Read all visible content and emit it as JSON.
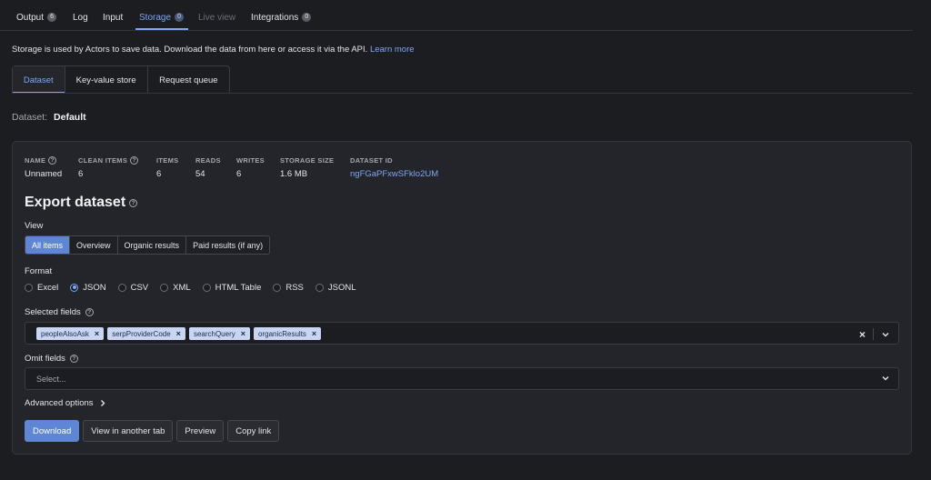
{
  "tabs": [
    {
      "label": "Output",
      "count": "6"
    },
    {
      "label": "Log"
    },
    {
      "label": "Input"
    },
    {
      "label": "Storage",
      "count": "0"
    },
    {
      "label": "Live view"
    },
    {
      "label": "Integrations",
      "count": "0"
    }
  ],
  "intro": {
    "text": "Storage is used by Actors to save data. Download the data from here or access it via the API.",
    "link": "Learn more"
  },
  "subtabs": [
    "Dataset",
    "Key-value store",
    "Request queue"
  ],
  "dataset_label": {
    "key": "Dataset:",
    "value": "Default"
  },
  "stats": [
    {
      "label": "NAME",
      "value": "Unnamed"
    },
    {
      "label": "CLEAN ITEMS",
      "value": "6"
    },
    {
      "label": "ITEMS",
      "value": "6"
    },
    {
      "label": "READS",
      "value": "54"
    },
    {
      "label": "WRITES",
      "value": "6"
    },
    {
      "label": "STORAGE SIZE",
      "value": "1.6 MB"
    },
    {
      "label": "DATASET ID",
      "value": "ngFGaPFxwSFklo2UM"
    }
  ],
  "export": {
    "title": "Export dataset",
    "view_label": "View",
    "view_options": [
      "All items",
      "Overview",
      "Organic results",
      "Paid results (if any)"
    ],
    "format_label": "Format",
    "formats": [
      "Excel",
      "JSON",
      "CSV",
      "XML",
      "HTML Table",
      "RSS",
      "JSONL"
    ],
    "selected_format": "JSON",
    "selected_fields_label": "Selected fields",
    "selected_fields": [
      "peopleAlsoAsk",
      "serpProviderCode",
      "searchQuery",
      "organicResults"
    ],
    "omit_fields_label": "Omit fields",
    "omit_placeholder": "Select...",
    "advanced": "Advanced options",
    "buttons": [
      "Download",
      "View in another tab",
      "Preview",
      "Copy link"
    ]
  },
  "colors": {
    "accent": "#7ea6f5",
    "primary_button": "#5e86d4",
    "background": "#1c1d21",
    "card": "#24252a"
  }
}
